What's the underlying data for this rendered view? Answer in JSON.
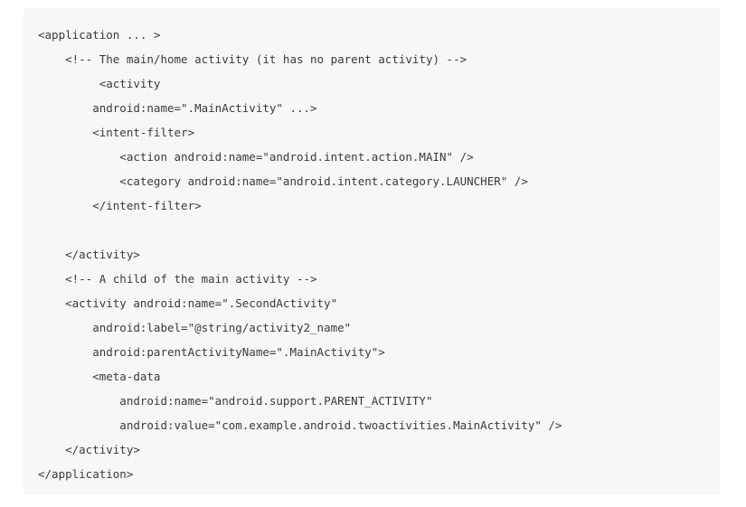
{
  "code": {
    "lines": [
      "<application ... >",
      "    <!-- The main/home activity (it has no parent activity) -->",
      "         <activity",
      "        android:name=\".MainActivity\" ...>",
      "        <intent-filter>",
      "            <action android:name=\"android.intent.action.MAIN\" />",
      "            <category android:name=\"android.intent.category.LAUNCHER\" />",
      "        </intent-filter>",
      "",
      "    </activity>",
      "    <!-- A child of the main activity -->",
      "    <activity android:name=\".SecondActivity\"",
      "        android:label=\"@string/activity2_name\"",
      "        android:parentActivityName=\".MainActivity\">",
      "        <meta-data",
      "            android:name=\"android.support.PARENT_ACTIVITY\"",
      "            android:value=\"com.example.android.twoactivities.MainActivity\" />",
      "    </activity>",
      "</application>"
    ]
  }
}
